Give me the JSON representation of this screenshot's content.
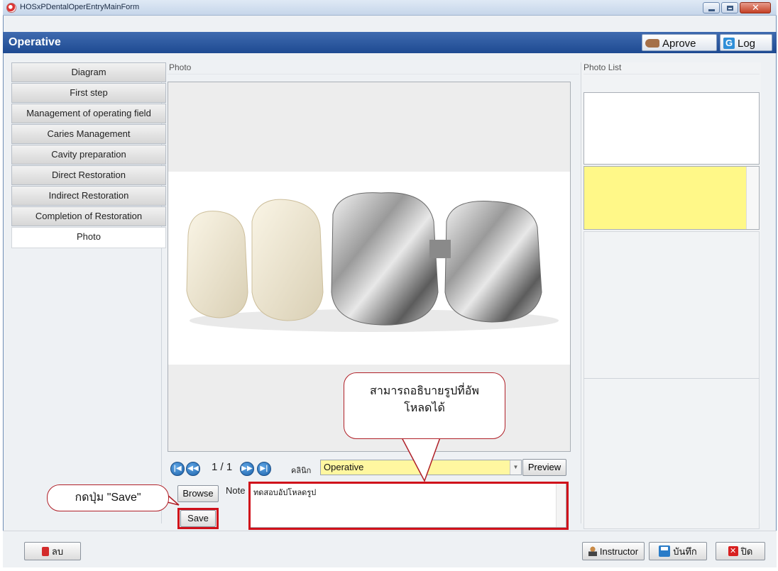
{
  "window": {
    "title": "HOSxPDentalOperEntryMainForm"
  },
  "header": {
    "caption": "Operative",
    "aprove_label": "Aprove",
    "log_label": "Log",
    "log_icon_text": "G"
  },
  "sidebar": {
    "items": [
      {
        "label": "Diagram"
      },
      {
        "label": "First step"
      },
      {
        "label": "Management of operating field"
      },
      {
        "label": "Caries Management"
      },
      {
        "label": "Cavity preparation"
      },
      {
        "label": "Direct Restoration"
      },
      {
        "label": "Indirect Restoration"
      },
      {
        "label": "Completion of Restoration"
      },
      {
        "label": "Photo"
      }
    ],
    "active_index": 8
  },
  "photo_panel": {
    "title": "Photo",
    "pager": "1 / 1",
    "clinic_label": "คลินิก",
    "clinic_value": "Operative",
    "preview_label": "Preview",
    "browse_label": "Browse",
    "note_label": "Note",
    "note_value": "ทดสอบอัปโหลดรูป",
    "save_label": "Save"
  },
  "photo_list": {
    "title": "Photo List"
  },
  "footer": {
    "delete_label": "ลบ",
    "instructor_label": "Instructor",
    "save_label": "บันทึก",
    "close_label": "ปิด"
  },
  "annotations": {
    "callout_note_line1": "สามารถอธิบายรูปที่อัพ",
    "callout_note_line2": "โหลดได้",
    "callout_save": "กดปุ่ม \"Save\""
  },
  "colors": {
    "header_blue": "#1e4a92",
    "highlight_red": "#d0101a",
    "clinic_yellow": "#fff7a0",
    "photo_list_yellow": "#fff888"
  }
}
